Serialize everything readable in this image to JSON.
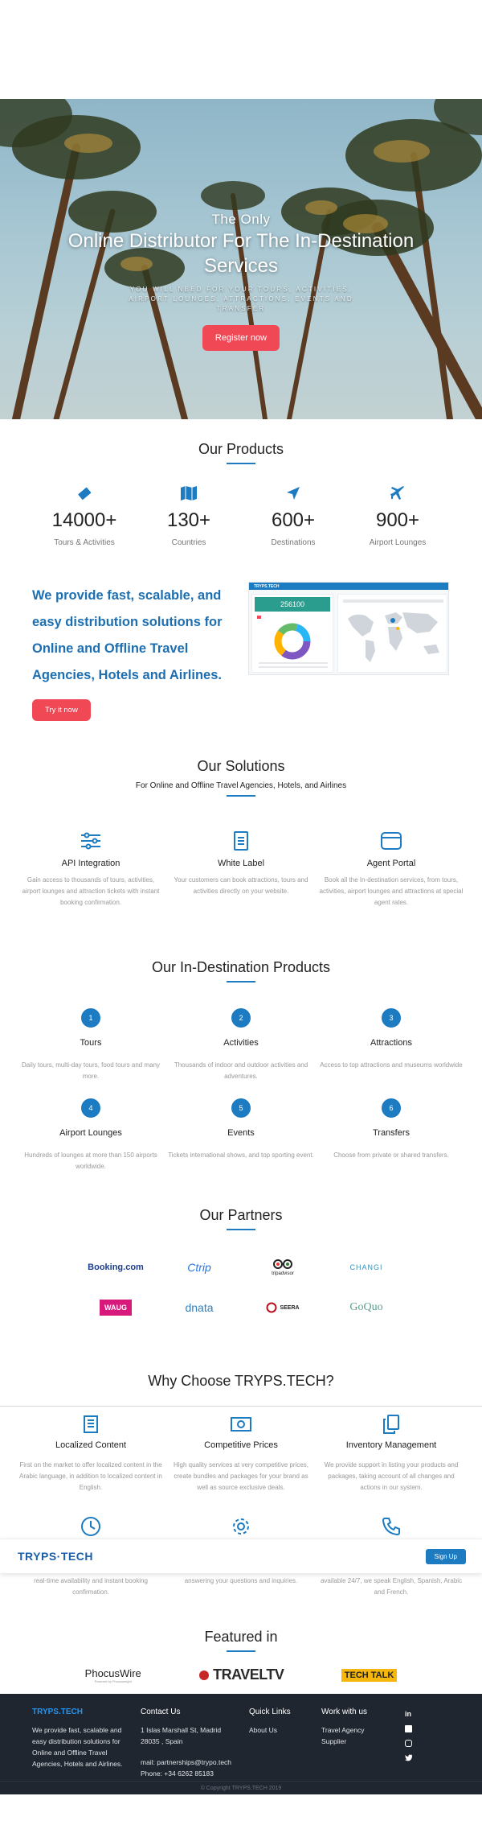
{
  "hero": {
    "kicker": "The Only",
    "title": "Online Distributor For The In-Destination Services",
    "subtitle": "YOU WILL NEED FOR YOUR TOURS, ACTIVITIES, AIRPORT LOUNGES, ATTRACTIONS, EVENTS AND TRANSFER",
    "cta": "Register now"
  },
  "products": {
    "title": "Our Products",
    "stats": [
      {
        "value": "14000+",
        "label": "Tours & Activities",
        "icon": "ticket-icon"
      },
      {
        "value": "130+",
        "label": "Countries",
        "icon": "map-icon"
      },
      {
        "value": "600+",
        "label": "Destinations",
        "icon": "location-arrow-icon"
      },
      {
        "value": "900+",
        "label": "Airport Lounges",
        "icon": "plane-icon"
      }
    ]
  },
  "promo": {
    "text": "We provide fast, scalable, and easy distribution solutions for Online and Offline Travel Agencies, Hotels and Airlines.",
    "cta": "Try it now",
    "dashboard": {
      "brand": "TRYPS.TECH",
      "kpi": "256100"
    }
  },
  "solutions": {
    "title": "Our Solutions",
    "subtitle": "For Online and Offline Travel Agencies, Hotels, and Airlines",
    "items": [
      {
        "title": "API Integration",
        "desc": "Gain access to thousands of tours, activities, airport lounges and attraction tickets with instant booking confirmation.",
        "icon": "sliders-icon"
      },
      {
        "title": "White Label",
        "desc": "Your customers can book attractions, tours and activities directly on your website.",
        "icon": "document-icon"
      },
      {
        "title": "Agent Portal",
        "desc": "Book all the In-destination services, from tours, activities, airport lounges and attractions at special agent rates.",
        "icon": "browser-window-icon"
      }
    ]
  },
  "indest": {
    "title": "Our In-Destination Products",
    "items": [
      {
        "n": "1",
        "title": "Tours",
        "desc": "Daily tours, multi-day tours, food tours and many more."
      },
      {
        "n": "2",
        "title": "Activities",
        "desc": "Thousands of indoor and outdoor activities and adventures."
      },
      {
        "n": "3",
        "title": "Attractions",
        "desc": "Access to top attractions and museums worldwide"
      },
      {
        "n": "4",
        "title": "Airport Lounges",
        "desc": "Hundreds of lounges at more than 150 airports worldwide."
      },
      {
        "n": "5",
        "title": "Events",
        "desc": "Tickets international shows, and top sporting event."
      },
      {
        "n": "6",
        "title": "Transfers",
        "desc": "Choose from private or shared transfers."
      }
    ]
  },
  "partners": {
    "title": "Our Partners",
    "row1": [
      {
        "name": "Booking.com",
        "color": "#1d3f8f"
      },
      {
        "name": "Ctrip",
        "color": "#2577e3"
      },
      {
        "name": "tripadvisor",
        "color": "#222222"
      },
      {
        "name": "CHANGI",
        "color": "#3a8fb7"
      }
    ],
    "row2": [
      {
        "name": "WAUG",
        "color": "#d6197b"
      },
      {
        "name": "dnata",
        "color": "#2f7fbe"
      },
      {
        "name": "SEERA",
        "color": "#b8121f"
      },
      {
        "name": "GoQuo",
        "color": "#5a9e8e"
      }
    ]
  },
  "why": {
    "title": "Why Choose TRYPS.TECH?",
    "items": [
      {
        "title": "Localized Content",
        "desc": "First on the market to offer localized content in the Arabic language, in addition to localized content in English.",
        "icon": "document-lines-icon"
      },
      {
        "title": "Competitive Prices",
        "desc": "High quality services at very competitive prices, create bundles and packages for your brand as well as source exclusive deals.",
        "icon": "money-icon"
      },
      {
        "title": "Inventory Management",
        "desc": "We provide support in listing your products and packages, taking account of all changes and actions in our system.",
        "icon": "copy-icon"
      }
    ],
    "row2_partial": [
      {
        "desc": "real-time availability and instant booking confirmation.",
        "icon": "clock-icon"
      },
      {
        "desc": "answering your questions and inquiries.",
        "icon": "gear-icon"
      },
      {
        "desc": "available 24/7, we speak English, Spanish, Arabic and French.",
        "icon": "phone-icon"
      }
    ]
  },
  "sticky": {
    "logo": "TRYPS·TECH",
    "cta": "Sign Up"
  },
  "featured": {
    "title": "Featured in",
    "logos": [
      {
        "name": "PhocusWire",
        "tag": "Powered by Phocuswright"
      },
      {
        "name": "TRAVELTV"
      },
      {
        "name": "TECH TALK"
      }
    ]
  },
  "footer": {
    "brand": "TRYPS.TECH",
    "about": "We provide fast, scalable and easy distribution solutions for Online and Offline Travel Agencies, Hotels and Airlines.",
    "contact": {
      "head": "Contact Us",
      "address1": "1 Islas Marshall St, Madrid",
      "address2": "28035 , Spain",
      "mail": "mail: partnerships@trypo.tech",
      "phone": "Phone: +34 6262 85183"
    },
    "quick": {
      "head": "Quick Links",
      "link": "About Us"
    },
    "work": {
      "head": "Work with us",
      "link1": "Travel Agency",
      "link2": "Supplier"
    },
    "social": [
      "linkedin-icon",
      "facebook-icon",
      "instagram-icon",
      "twitter-icon"
    ],
    "copyright": "© Copyright TRYPS.TECH 2019"
  },
  "colors": {
    "accent": "#1d7bc1",
    "cta": "#f04855",
    "footer_bg": "#20262f"
  }
}
